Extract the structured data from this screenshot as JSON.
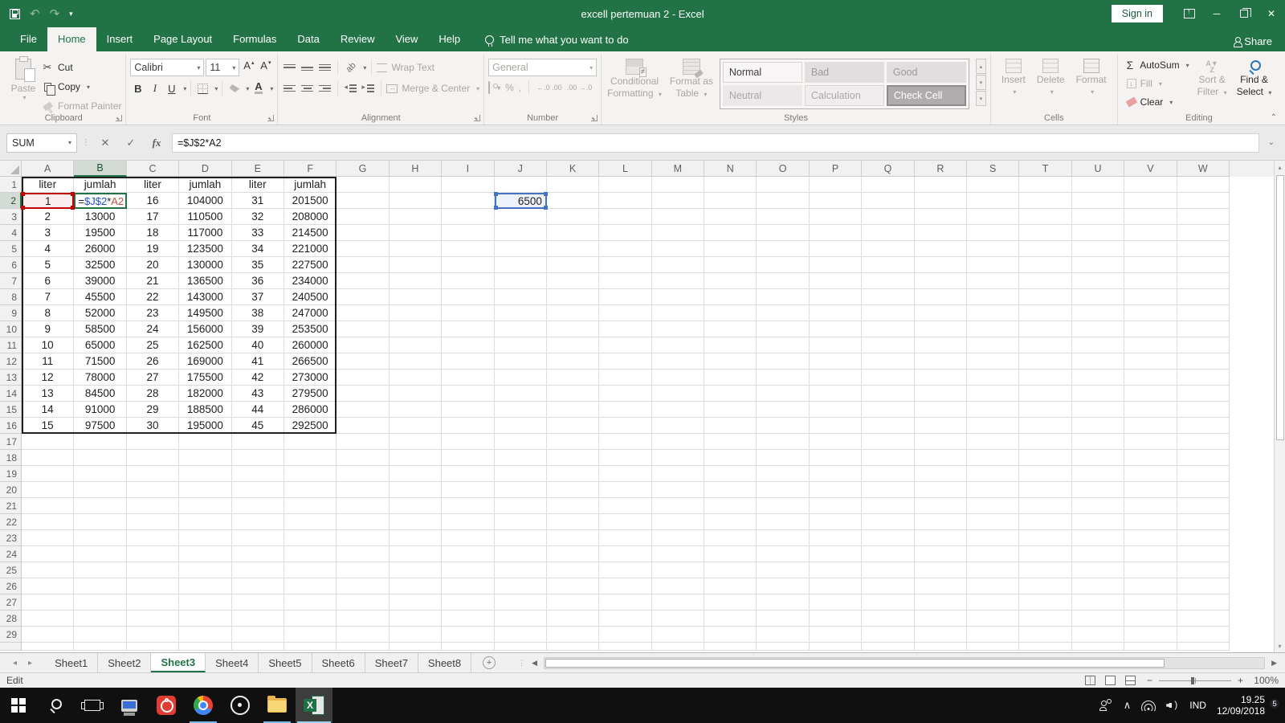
{
  "titlebar": {
    "title": "excell pertemuan 2  -  Excel",
    "sign_in": "Sign in"
  },
  "ribbon_tabs": {
    "items": [
      {
        "label": "File",
        "active": false
      },
      {
        "label": "Home",
        "active": true
      },
      {
        "label": "Insert",
        "active": false
      },
      {
        "label": "Page Layout",
        "active": false
      },
      {
        "label": "Formulas",
        "active": false
      },
      {
        "label": "Data",
        "active": false
      },
      {
        "label": "Review",
        "active": false
      },
      {
        "label": "View",
        "active": false
      },
      {
        "label": "Help",
        "active": false
      }
    ],
    "tell_me": "Tell me what you want to do",
    "share": "Share"
  },
  "ribbon": {
    "clipboard": {
      "label": "Clipboard",
      "paste": "Paste",
      "cut": "Cut",
      "copy": "Copy",
      "format_painter": "Format Painter"
    },
    "font": {
      "label": "Font",
      "family": "Calibri",
      "size": "11",
      "bold": "B",
      "italic": "I",
      "underline": "U",
      "grow": "A",
      "shrink": "A"
    },
    "alignment": {
      "label": "Alignment",
      "wrap_text": "Wrap Text",
      "merge_center": "Merge & Center"
    },
    "number": {
      "label": "Number",
      "format": "General",
      "percent": "%",
      "comma": ",",
      "inc_dec": "←.0 .00",
      "dec_dec": ".00 →.0"
    },
    "styles": {
      "label": "Styles",
      "conditional_1": "Conditional",
      "conditional_2": "Formatting",
      "format_table_1": "Format as",
      "format_table_2": "Table",
      "gallery": [
        "Normal",
        "Bad",
        "Good",
        "Neutral",
        "Calculation",
        "Check Cell"
      ]
    },
    "cells": {
      "label": "Cells",
      "insert": "Insert",
      "delete": "Delete",
      "format": "Format"
    },
    "editing": {
      "label": "Editing",
      "autosum": "AutoSum",
      "fill": "Fill",
      "clear": "Clear",
      "sort_1": "Sort &",
      "sort_2": "Filter",
      "find_1": "Find &",
      "find_2": "Select"
    }
  },
  "formula_bar": {
    "name_box": "SUM",
    "formula": "=$J$2*A2"
  },
  "grid": {
    "columns": [
      "A",
      "B",
      "C",
      "D",
      "E",
      "F",
      "G",
      "H",
      "I",
      "J",
      "K",
      "L",
      "M",
      "N",
      "O",
      "P",
      "Q",
      "R",
      "S",
      "T",
      "U",
      "V",
      "W"
    ],
    "visible_rows": 29,
    "selection": {
      "col": "B",
      "row": 2
    },
    "table": {
      "headers": [
        "liter",
        "jumlah",
        "liter",
        "jumlah",
        "liter",
        "jumlah"
      ],
      "rows": [
        [
          1,
          null,
          16,
          104000,
          31,
          201500
        ],
        [
          2,
          13000,
          17,
          110500,
          32,
          208000
        ],
        [
          3,
          19500,
          18,
          117000,
          33,
          214500
        ],
        [
          4,
          26000,
          19,
          123500,
          34,
          221000
        ],
        [
          5,
          32500,
          20,
          130000,
          35,
          227500
        ],
        [
          6,
          39000,
          21,
          136500,
          36,
          234000
        ],
        [
          7,
          45500,
          22,
          143000,
          37,
          240500
        ],
        [
          8,
          52000,
          23,
          149500,
          38,
          247000
        ],
        [
          9,
          58500,
          24,
          156000,
          39,
          253500
        ],
        [
          10,
          65000,
          25,
          162500,
          40,
          260000
        ],
        [
          11,
          71500,
          26,
          169000,
          41,
          266500
        ],
        [
          12,
          78000,
          27,
          175500,
          42,
          273000
        ],
        [
          13,
          84500,
          28,
          182000,
          43,
          279500
        ],
        [
          14,
          91000,
          29,
          188500,
          44,
          286000
        ],
        [
          15,
          97500,
          30,
          195000,
          45,
          292500
        ]
      ]
    },
    "b2_formula_parts": [
      {
        "text": "=",
        "color": "black"
      },
      {
        "text": "$J$2",
        "color": "blue"
      },
      {
        "text": "*",
        "color": "black"
      },
      {
        "text": "A2",
        "color": "red"
      }
    ],
    "j2": {
      "col": "J",
      "row": 2,
      "value": "6500"
    }
  },
  "sheet_tabs": {
    "tabs": [
      "Sheet1",
      "Sheet2",
      "Sheet3",
      "Sheet4",
      "Sheet5",
      "Sheet6",
      "Sheet7",
      "Sheet8"
    ],
    "active": "Sheet3",
    "new_sheet": "+"
  },
  "status_bar": {
    "mode": "Edit",
    "zoom": "100%"
  },
  "taskbar": {
    "language": "IND",
    "time": "19.25",
    "date": "12/09/2018",
    "notification_count": "5"
  },
  "glyphs": {
    "dropdown": "▾",
    "up_small": "▴",
    "scissors": "✂",
    "undo": "↶",
    "redo": "↷",
    "close": "✕",
    "minimize": "─",
    "cancel": "✕",
    "enter": "✓",
    "fx": "fx",
    "sigma": "Σ",
    "chevron_up": "⌃",
    "chevron_down": "⌄",
    "left": "◂",
    "right": "▸",
    "scroll_left": "◀",
    "scroll_right": "▶",
    "dots_v": "⋮",
    "minus": "−",
    "plus": "+",
    "tray_chevron": "∧",
    "orient": "ab",
    "az": "A\nZ"
  },
  "colors": {
    "accent_green": "#217346",
    "ref_red": "#c00000",
    "ref_blue": "#4472c4",
    "taskbar_underline": "#76b9e8"
  }
}
